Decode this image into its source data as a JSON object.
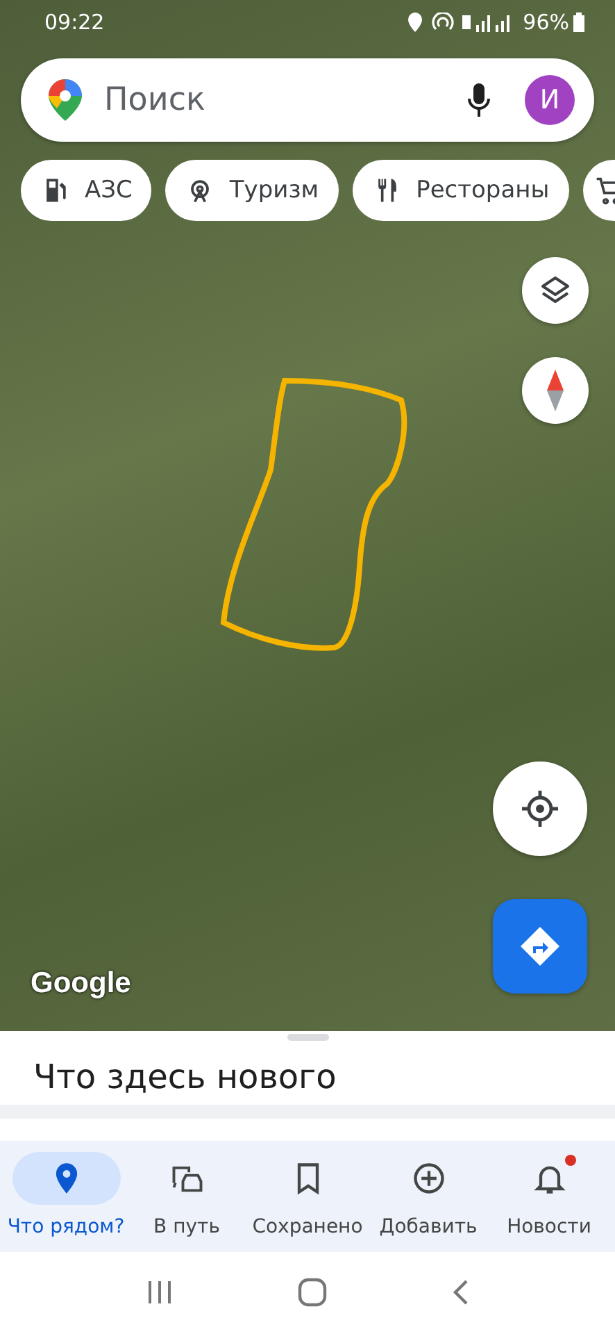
{
  "status_bar": {
    "time": "09:22",
    "battery": "96%"
  },
  "search": {
    "placeholder": "Поиск",
    "avatar_letter": "И"
  },
  "chips": [
    {
      "kind": "fuel",
      "label": "АЗС"
    },
    {
      "kind": "attraction",
      "label": "Туризм"
    },
    {
      "kind": "restaurant",
      "label": "Рестораны"
    }
  ],
  "map": {
    "attribution": "Google"
  },
  "sheet": {
    "title": "Что здесь нового"
  },
  "bottom_nav": [
    {
      "kind": "explore",
      "label": "Что рядом?",
      "selected": true,
      "badge": false
    },
    {
      "kind": "commute",
      "label": "В путь",
      "selected": false,
      "badge": false
    },
    {
      "kind": "saved",
      "label": "Сохранено",
      "selected": false,
      "badge": false
    },
    {
      "kind": "contribute",
      "label": "Добавить",
      "selected": false,
      "badge": false
    },
    {
      "kind": "updates",
      "label": "Новости",
      "selected": false,
      "badge": true
    }
  ]
}
